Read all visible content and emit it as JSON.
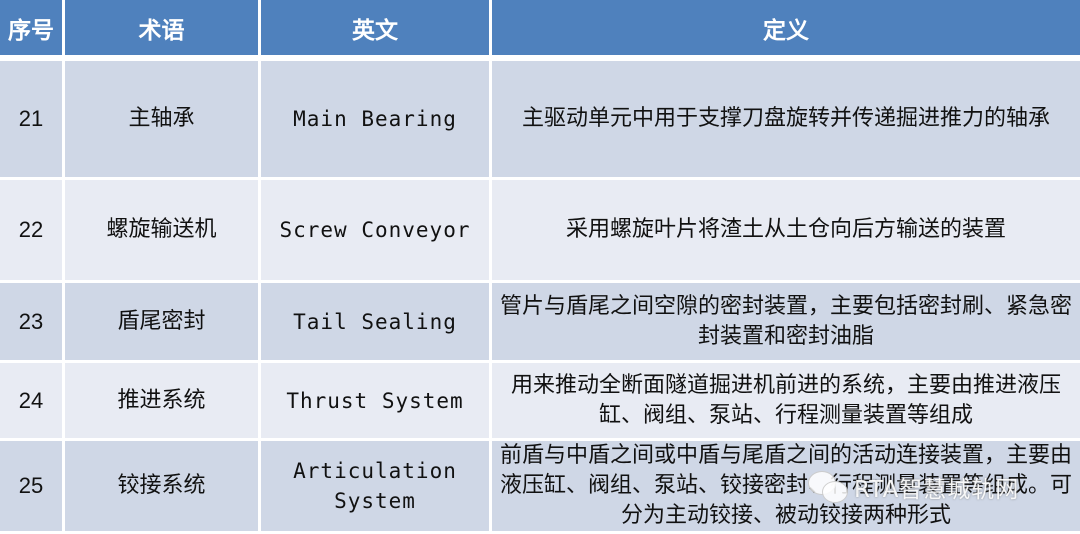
{
  "table": {
    "headers": [
      "序号",
      "术语",
      "英文",
      "定义"
    ],
    "rows": [
      {
        "no": "21",
        "term": "主轴承",
        "english": "Main Bearing",
        "definition": "主驱动单元中用于支撑刀盘旋转并传递掘进推力的轴承"
      },
      {
        "no": "22",
        "term": "螺旋输送机",
        "english": "Screw Conveyor",
        "definition": "采用螺旋叶片将渣土从土仓向后方输送的装置"
      },
      {
        "no": "23",
        "term": "盾尾密封",
        "english": "Tail Sealing",
        "definition": "管片与盾尾之间空隙的密封装置，主要包括密封刷、紧急密封装置和密封油脂"
      },
      {
        "no": "24",
        "term": "推进系统",
        "english": "Thrust System",
        "definition": "用来推动全断面隧道掘进机前进的系统，主要由推进液压缸、阀组、泵站、行程测量装置等组成"
      },
      {
        "no": "25",
        "term": "铰接系统",
        "english": "Articulation System",
        "definition": "前盾与中盾之间或中盾与尾盾之间的活动连接装置，主要由液压缸、阀组、泵站、铰接密封、行程测量装置等组成。可分为主动铰接、被动铰接两种形式"
      }
    ]
  },
  "watermark": {
    "icon": "wechat-icon",
    "text": "RTA智慧城轨网"
  },
  "colors": {
    "header_bg": "#4f81bd",
    "row_odd": "#cfd7e6",
    "row_even": "#e8ebf3"
  }
}
